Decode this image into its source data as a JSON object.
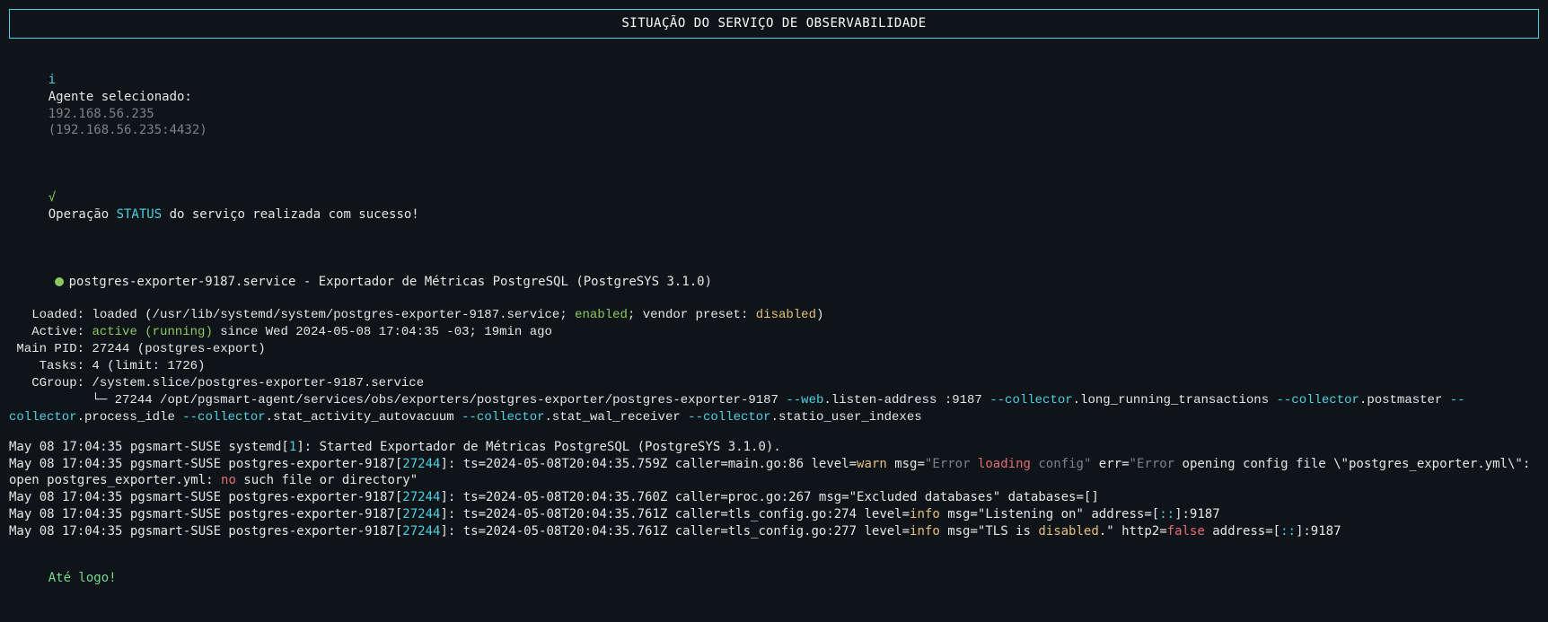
{
  "colors": {
    "accent_cyan": "#4dd0e1",
    "text_white": "#e6e6e6",
    "text_grey": "#7a828c",
    "green": "#8cc85f",
    "orange": "#e5c07b",
    "red": "#e06c75",
    "blue": "#61afef",
    "bg": "#0f1419"
  },
  "header": {
    "title": "SITUAÇÃO DO SERVIÇO DE OBSERVABILIDADE"
  },
  "agent": {
    "info_glyph": "i",
    "label": "Agente selecionado:",
    "ip": "192.168.56.235",
    "address": "(192.168.56.235:4432)"
  },
  "status_op": {
    "check_glyph": "√",
    "pre": "Operação ",
    "op": "STATUS",
    "post": " do serviço realizada com sucesso!"
  },
  "service": {
    "name": "postgres-exporter-9187.service",
    "desc": " - Exportador de Métricas PostgreSQL (PostgreSYS 3.1.0)",
    "loaded_prefix": "   Loaded: loaded (/usr/lib/systemd/system/postgres-exporter-9187.service; ",
    "loaded_enabled": "enabled",
    "loaded_mid": "; vendor preset: ",
    "loaded_preset": "disabled",
    "loaded_suffix": ")",
    "active_prefix": "   Active: ",
    "active_state": "active (running)",
    "active_since": " since Wed 2024-05-08 17:04:35 -03; 19min ago",
    "main_pid": " Main PID: 27244 (postgres-export)",
    "tasks": "    Tasks: 4 (limit: 1726)",
    "cgroup": "   CGroup: /system.slice/postgres-exporter-9187.service",
    "tree_glyph": "           └─ ",
    "cmd_pid_path": "27244 /opt/pgsmart-agent/services/obs/exporters/postgres-exporter/postgres-exporter-9187 ",
    "flags": [
      {
        "k": "--web",
        "v": ".listen-address :9187 "
      },
      {
        "k": "--collector",
        "v": ".long_running_transactions "
      },
      {
        "k": "--collector",
        "v": ".postmaster "
      },
      {
        "k": "--collector",
        "v": ".process_idle "
      },
      {
        "k": "--collector",
        "v": ".stat_activity_autovacuum "
      },
      {
        "k": "--collector",
        "v": ".stat_wal_receiver "
      },
      {
        "k": "--collector",
        "v": ".statio_user_indexes"
      }
    ]
  },
  "logs": [
    {
      "segments": [
        {
          "t": "May 08 17:04:35 pgsmart-SUSE systemd[",
          "c": "white"
        },
        {
          "t": "1",
          "c": "cyan"
        },
        {
          "t": "]: Started Exportador de Métricas PostgreSQL (PostgreSYS 3.1.0).",
          "c": "white"
        }
      ]
    },
    {
      "segments": [
        {
          "t": "May 08 17:04:35 pgsmart-SUSE postgres-exporter-9187[",
          "c": "white"
        },
        {
          "t": "27244",
          "c": "cyan"
        },
        {
          "t": "]: ts=2024-05-08T20:04:35.759Z caller=main.go:86 level=",
          "c": "white"
        },
        {
          "t": "warn",
          "c": "orange"
        },
        {
          "t": " msg=",
          "c": "white"
        },
        {
          "t": "\"Error",
          "c": "grey"
        },
        {
          "t": " loading",
          "c": "red"
        },
        {
          "t": " config\"",
          "c": "grey"
        },
        {
          "t": " err=",
          "c": "white"
        },
        {
          "t": "\"Error",
          "c": "grey"
        },
        {
          "t": " opening config file \\\"postgres_exporter.yml\\\": open postgres_exporter.yml: ",
          "c": "white"
        },
        {
          "t": "no",
          "c": "red"
        },
        {
          "t": " such file or directory\"",
          "c": "white"
        }
      ]
    },
    {
      "segments": [
        {
          "t": "May 08 17:04:35 pgsmart-SUSE postgres-exporter-9187[",
          "c": "white"
        },
        {
          "t": "27244",
          "c": "cyan"
        },
        {
          "t": "]: ts=2024-05-08T20:04:35.760Z caller=proc.go:267 msg=\"Excluded databases\" databases=[]",
          "c": "white"
        }
      ]
    },
    {
      "segments": [
        {
          "t": "May 08 17:04:35 pgsmart-SUSE postgres-exporter-9187[",
          "c": "white"
        },
        {
          "t": "27244",
          "c": "cyan"
        },
        {
          "t": "]: ts=2024-05-08T20:04:35.761Z caller=tls_config.go:274 level=",
          "c": "white"
        },
        {
          "t": "info",
          "c": "orange"
        },
        {
          "t": " msg=\"Listening on\" address=[",
          "c": "white"
        },
        {
          "t": "::",
          "c": "cyan"
        },
        {
          "t": "]:9187",
          "c": "white"
        }
      ]
    },
    {
      "segments": [
        {
          "t": "May 08 17:04:35 pgsmart-SUSE postgres-exporter-9187[",
          "c": "white"
        },
        {
          "t": "27244",
          "c": "cyan"
        },
        {
          "t": "]: ts=2024-05-08T20:04:35.761Z caller=tls_config.go:277 level=",
          "c": "white"
        },
        {
          "t": "info",
          "c": "orange"
        },
        {
          "t": " msg=\"TLS is ",
          "c": "white"
        },
        {
          "t": "disabled",
          "c": "orange"
        },
        {
          "t": ".\" http2=",
          "c": "white"
        },
        {
          "t": "false",
          "c": "red"
        },
        {
          "t": " address=[",
          "c": "white"
        },
        {
          "t": "::",
          "c": "cyan"
        },
        {
          "t": "]:9187",
          "c": "white"
        }
      ]
    }
  ],
  "footer": {
    "goodbye": "Até logo!"
  }
}
